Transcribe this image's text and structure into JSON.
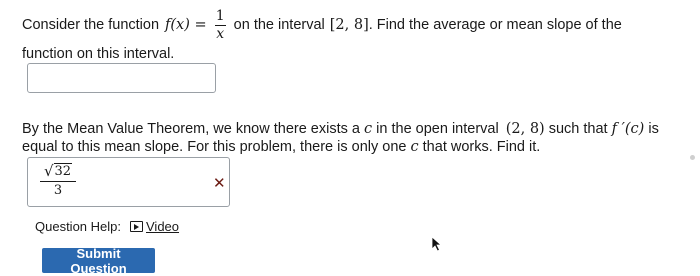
{
  "question1": {
    "intro": "Consider the function",
    "function_lhs": "f(x) =",
    "frac_num": "1",
    "frac_den": "x",
    "middle": "on the interval",
    "interval": "[2, 8]",
    "tail": ". Find the average or mean slope of the",
    "line2": "function on this interval.",
    "answer_value": ""
  },
  "question2": {
    "line1_a": "By the Mean Value Theorem, we know there exists a",
    "var_c": "c",
    "line1_b": "in the open interval",
    "open_interval": "(2, 8)",
    "line1_c": "such that",
    "derivative": "f ′(c)",
    "line1_d": "is",
    "line2_a": "equal to this mean slope. For this problem, there is only one",
    "line2_b": "that works. Find it.",
    "answer": {
      "radicand": "32",
      "denominator": "3",
      "status_icon": "x-mark-icon",
      "status_color": "#6b1a12"
    }
  },
  "help": {
    "label": "Question Help:",
    "video_label": "Video",
    "video_icon": "play-video-icon"
  },
  "submit": {
    "label": "Submit Question",
    "color": "#2b69b0"
  }
}
